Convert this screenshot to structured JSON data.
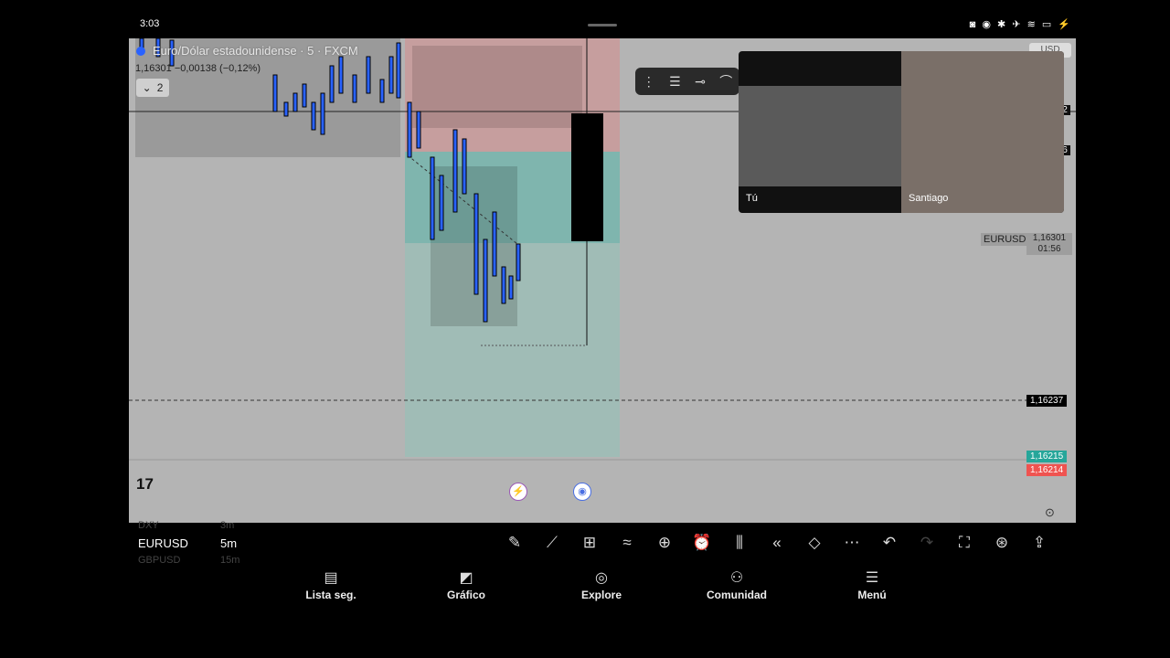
{
  "status": {
    "time": "3:03",
    "right": "◙ ◉ ✱ ✈ ≋ ▭ ⚡"
  },
  "chart": {
    "symbol_title": "Euro/Dólar estadounidense · 5 · FXCM",
    "change": "1,16301 −0,00138 (−0,12%)",
    "indicator_count": "2",
    "eurusd_label": "EURUSD",
    "eurusd_price": "1,16301",
    "eurusd_timer": "01:56",
    "dashed_price": "1,16237",
    "bid": "1,16215",
    "ask": "1,16214",
    "side_a": "2",
    "side_b": "6",
    "usd": "USD",
    "tv_logo": "17"
  },
  "video": {
    "you": "Tú",
    "other": "Santiago"
  },
  "bottom": {
    "ticker_prev": "DXY",
    "ticker": "EURUSD",
    "ticker_next": "GBPUSD",
    "tf_prev": "3m",
    "tf": "5m",
    "tf_next": "15m",
    "tools": [
      "pencil-icon",
      "chart-indicators-icon",
      "grid-icon",
      "trend-lines-icon",
      "plus-circle-icon",
      "alarm-icon",
      "candles-icon",
      "rewind-icon",
      "layers-icon",
      "more-icon",
      "undo-icon",
      "redo-icon",
      "fullscreen-icon",
      "idea-icon",
      "share-icon"
    ]
  },
  "nav": {
    "watchlist": "Lista seg.",
    "chart": "Gráfico",
    "explore": "Explore",
    "community": "Comunidad",
    "menu": "Menú"
  }
}
